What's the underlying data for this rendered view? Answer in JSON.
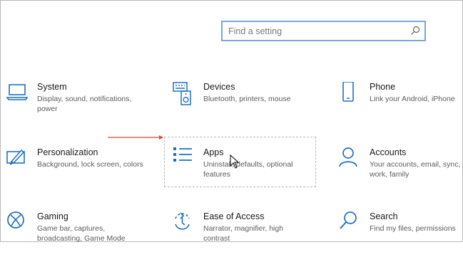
{
  "search": {
    "placeholder": "Find a setting",
    "icon": "search-icon"
  },
  "accent": "#1f6fc5",
  "tiles": [
    {
      "title": "System",
      "desc": "Display, sound, notifications, power",
      "icon": "laptop-icon"
    },
    {
      "title": "Devices",
      "desc": "Bluetooth, printers, mouse",
      "icon": "keyboard-speaker-icon"
    },
    {
      "title": "Phone",
      "desc": "Link your Android, iPhone",
      "icon": "phone-icon"
    },
    {
      "title": "Personalization",
      "desc": "Background, lock screen, colors",
      "icon": "paintbrush-icon"
    },
    {
      "title": "Apps",
      "desc": "Uninstall, defaults, optional features",
      "icon": "apps-list-icon"
    },
    {
      "title": "Accounts",
      "desc": "Your accounts, email, sync, work, family",
      "icon": "person-icon"
    },
    {
      "title": "Gaming",
      "desc": "Game bar, captures, broadcasting, Game Mode",
      "icon": "xbox-icon"
    },
    {
      "title": "Ease of Access",
      "desc": "Narrator, magnifier, high contrast",
      "icon": "ease-of-access-icon"
    },
    {
      "title": "Search",
      "desc": "Find my files, permissions",
      "icon": "search-icon"
    }
  ]
}
